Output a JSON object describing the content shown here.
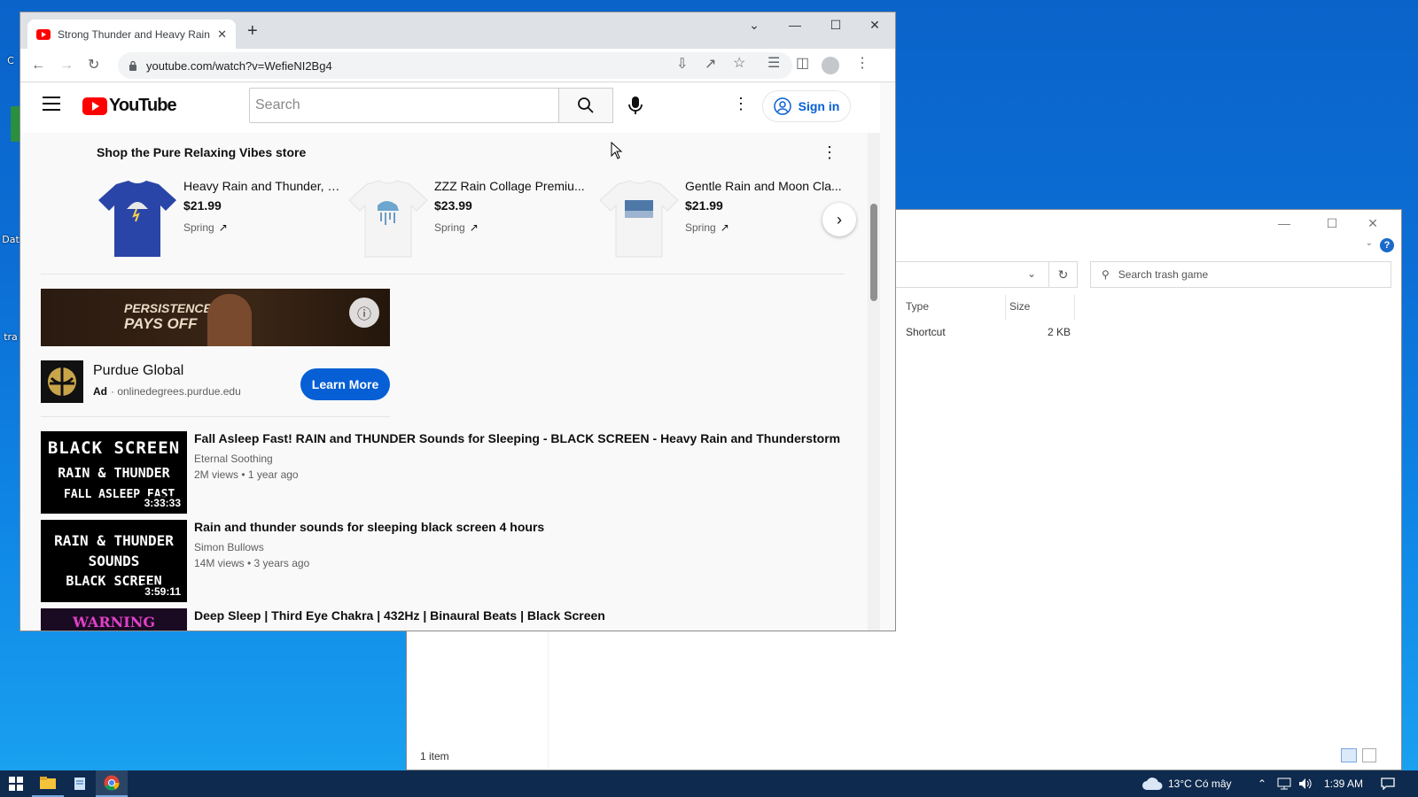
{
  "desktop": {
    "icon_labels": [
      "C",
      "Dat",
      "tra"
    ]
  },
  "explorer": {
    "search_placeholder": "Search trash game",
    "columns": [
      "Type",
      "Size"
    ],
    "row": {
      "type": "Shortcut",
      "size": "2 KB"
    },
    "status": "1 item",
    "help": "?"
  },
  "taskbar": {
    "weather": "13°C  Có mây",
    "clock": "1:39 AM"
  },
  "browser": {
    "tab_title": "Strong Thunder and Heavy Rain",
    "url": "youtube.com/watch?v=WefieNI2Bg4"
  },
  "youtube": {
    "logo": "YouTube",
    "search_placeholder": "Search",
    "signin": "Sign in",
    "store_title": "Shop the Pure Relaxing Vibes store",
    "products": [
      {
        "name": "Heavy Rain and Thunder, d...",
        "price": "$21.99",
        "source": "Spring"
      },
      {
        "name": "ZZZ Rain Collage Premiu...",
        "price": "$23.99",
        "source": "Spring"
      },
      {
        "name": "Gentle Rain and Moon Cla...",
        "price": "$21.99",
        "source": "Spring"
      }
    ],
    "ad": {
      "banner_line1": "PERSISTENCE",
      "banner_line2": "PAYS OFF",
      "advertiser": "Purdue Global",
      "ad_label": "Ad",
      "ad_url": "· onlinedegrees.purdue.edu",
      "cta": "Learn More"
    },
    "videos": [
      {
        "title": "Fall Asleep Fast! RAIN and THUNDER Sounds for Sleeping - BLACK SCREEN - Heavy Rain and Thunderstorm",
        "channel": "Eternal Soothing",
        "meta": "2M views • 1 year ago",
        "duration": "3:33:33",
        "thumb_lines": [
          "BLACK SCREEN",
          "RAIN & THUNDER",
          "FALL ASLEEP FAST"
        ]
      },
      {
        "title": "Rain and thunder sounds for sleeping black screen 4 hours",
        "channel": "Simon Bullows",
        "meta": "14M views • 3 years ago",
        "duration": "3:59:11",
        "thumb_lines": [
          "RAIN & THUNDER",
          "SOUNDS",
          "BLACK SCREEN"
        ]
      },
      {
        "title": "Deep Sleep | Third Eye Chakra | 432Hz | Binaural Beats | Black Screen",
        "channel": "",
        "meta": "",
        "duration": "",
        "thumb_lines": [
          "WARNING"
        ]
      }
    ]
  },
  "colors": {
    "yt_red": "#ff0000",
    "link_blue": "#065fd4",
    "cta_blue": "#065fd4",
    "taskbar": "#0e2a4e"
  }
}
